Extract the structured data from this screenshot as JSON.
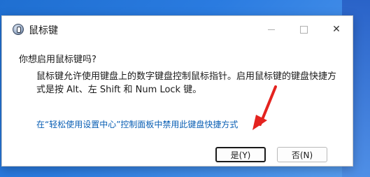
{
  "dialog": {
    "title": "鼠标键",
    "question": "你想启用鼠标键吗?",
    "description": "鼠标键允许使用键盘上的数字键盘控制鼠标指针。启用鼠标键的键盘快捷方式是按 Alt、左 Shift 和 Num Lock 键。",
    "link_text": "在“轻松使用设置中心”控制面板中禁用此键盘快捷方式",
    "yes_label": "是(Y)",
    "no_label": "否(N)",
    "close_glyph": "✕"
  },
  "colors": {
    "link": "#0a5fb4",
    "annotation_arrow": "#e4231f"
  },
  "icons": {
    "app": "mouse-keys-icon",
    "minimize": "minimize-icon",
    "maximize": "maximize-icon",
    "close": "close-icon"
  }
}
